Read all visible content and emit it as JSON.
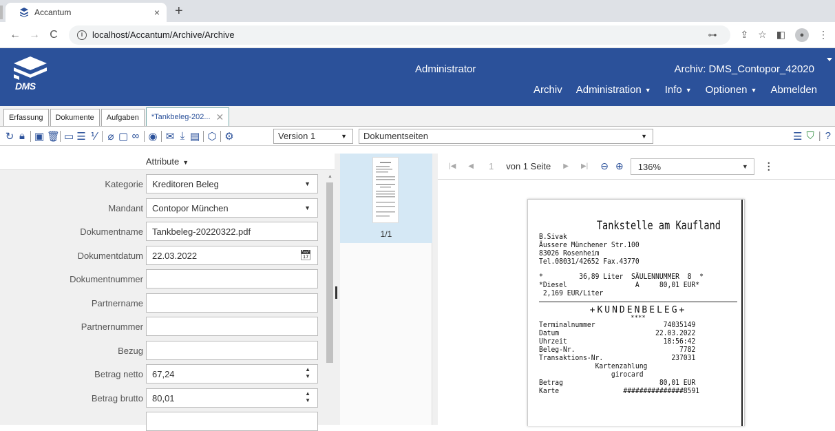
{
  "browser": {
    "tab_title": "Accantum",
    "tab_close": "×",
    "new_tab": "+",
    "url": "localhost/Accantum/Archive/Archive",
    "back": "←",
    "forward": "→",
    "reload": "C"
  },
  "header": {
    "logo_text": "DMS",
    "role": "Administrator",
    "archive": "Archiv: DMS_Contopor_42020",
    "nav": [
      {
        "label": "Archiv",
        "caret": false
      },
      {
        "label": "Administration",
        "caret": true
      },
      {
        "label": "Info",
        "caret": true
      },
      {
        "label": "Optionen",
        "caret": true
      },
      {
        "label": "Abmelden",
        "caret": false
      }
    ]
  },
  "app_tabs": [
    "Erfassung",
    "Dokumente",
    "Aufgaben",
    "*Tankbeleg-202..."
  ],
  "toolbar": {
    "version": "Version 1",
    "pages_select": "Dokumentseiten"
  },
  "attributes": {
    "header": "Attribute",
    "fields": [
      {
        "label": "Kategorie",
        "value": "Kreditoren Beleg",
        "kind": "select"
      },
      {
        "label": "Mandant",
        "value": "Contopor München",
        "kind": "select"
      },
      {
        "label": "Dokumentname",
        "value": "Tankbeleg-20220322.pdf",
        "kind": "text"
      },
      {
        "label": "Dokumentdatum",
        "value": "22.03.2022",
        "kind": "date"
      },
      {
        "label": "Dokumentnummer",
        "value": "",
        "kind": "text"
      },
      {
        "label": "Partnername",
        "value": "",
        "kind": "text"
      },
      {
        "label": "Partnernummer",
        "value": "",
        "kind": "text"
      },
      {
        "label": "Bezug",
        "value": "",
        "kind": "text"
      },
      {
        "label": "Betrag netto",
        "value": "67,24",
        "kind": "number"
      },
      {
        "label": "Betrag brutto",
        "value": "80,01",
        "kind": "number"
      }
    ]
  },
  "thumbnails": {
    "page_label": "1/1"
  },
  "viewer": {
    "page_number": "1",
    "page_of": "von 1 Seite",
    "zoom": "136%"
  },
  "receipt": {
    "title": "Tankstelle am Kaufland",
    "lines_top": [
      "B.Sivak",
      "Äussere Münchener Str.100",
      "83026 Rosenheim",
      "Tel.08031/42652 Fax.43770"
    ],
    "lines_fuel": [
      "*         36,89 Liter  SÄULENNUMMER  8  *",
      "*Diesel                 A     80,01 EUR*",
      " 2,169 EUR/Liter"
    ],
    "kundenbeleg": "+KUNDENBELEG+",
    "stars": "****",
    "lines_tx": [
      "Terminalnummer                 74035149",
      "Datum                        22.03.2022",
      "Uhrzeit                        18:56:42",
      "Beleg-Nr.                          7782",
      "Transaktions-Nr.                 237031",
      "              Kartenzahlung",
      "                  girocard",
      "Betrag                        80,01 EUR",
      "Karte                ###############8591"
    ]
  }
}
